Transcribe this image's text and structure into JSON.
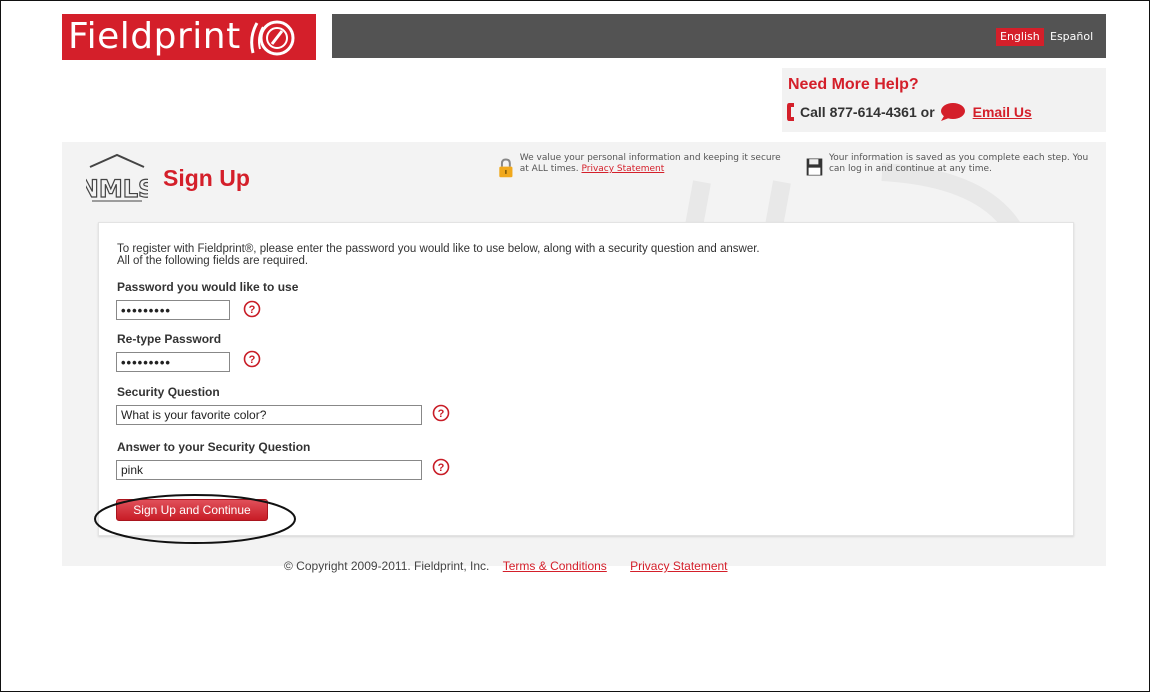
{
  "header": {
    "logo_text": "Fieldprint",
    "languages": [
      "English",
      "Español"
    ],
    "active_language": "English"
  },
  "help": {
    "title": "Need More Help?",
    "call_text": "Call 877-614-4361 or",
    "email_label": "Email Us"
  },
  "page": {
    "title": "Sign Up",
    "security_note": "We value your personal information and keeping it secure at ALL times.",
    "security_link": "Privacy Statement",
    "save_note": "Your information is saved as you complete each step. You can log in and continue at any time."
  },
  "form": {
    "intro_line1": "To register with Fieldprint®, please enter the password you would like to use below, along with a security question and answer.",
    "intro_line2": "All of the following fields are required.",
    "password_label": "Password you would like to use",
    "password_value": "•••••••••",
    "retype_label": "Re-type Password",
    "retype_value": "•••••••••",
    "question_label": "Security Question",
    "question_value": "What is your favorite color?",
    "answer_label": "Answer to your Security Question",
    "answer_value": "pink",
    "submit_label": "Sign Up and Continue"
  },
  "footer": {
    "copyright": "© Copyright 2009-2011. Fieldprint, Inc.",
    "terms_link": "Terms & Conditions",
    "privacy_link": "Privacy Statement"
  },
  "colors": {
    "brand_red": "#d41f2a",
    "topbar_gray": "#535353"
  }
}
